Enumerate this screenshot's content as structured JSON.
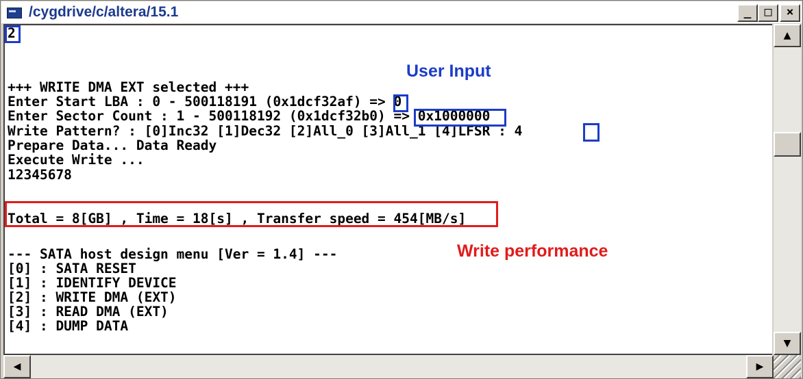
{
  "window": {
    "title": "/cygdrive/c/altera/15.1",
    "buttons": {
      "minimize": "_",
      "maximize": "□",
      "close": "×"
    }
  },
  "console": {
    "lines": [
      "2",
      "",
      "+++ WRITE DMA EXT selected +++",
      "Enter Start LBA : 0 - 500118191 (0x1dcf32af) => 0",
      "Enter Sector Count : 1 - 500118192 (0x1dcf32b0) => 0x1000000",
      "Write Pattern? : [0]Inc32 [1]Dec32 [2]All_0 [3]All_1 [4]LFSR : 4",
      "Prepare Data... Data Ready",
      "Execute Write ...",
      "12345678",
      "",
      "Total = 8[GB] , Time = 18[s] , Transfer speed = 454[MB/s]",
      "",
      "--- SATA host design menu [Ver = 1.4] ---",
      "[0] : SATA RESET",
      "[1] : IDENTIFY DEVICE",
      "[2] : WRITE DMA (EXT)",
      "[3] : READ DMA (EXT)",
      "[4] : DUMP DATA"
    ]
  },
  "annotations": {
    "user_input": "User Input",
    "write_performance": "Write performance",
    "colors": {
      "input_box": "#1c3cc8",
      "performance_box": "#e21b1b"
    }
  },
  "scrollbars": {
    "up": "▲",
    "down": "▼",
    "left": "◀",
    "right": "▶"
  }
}
